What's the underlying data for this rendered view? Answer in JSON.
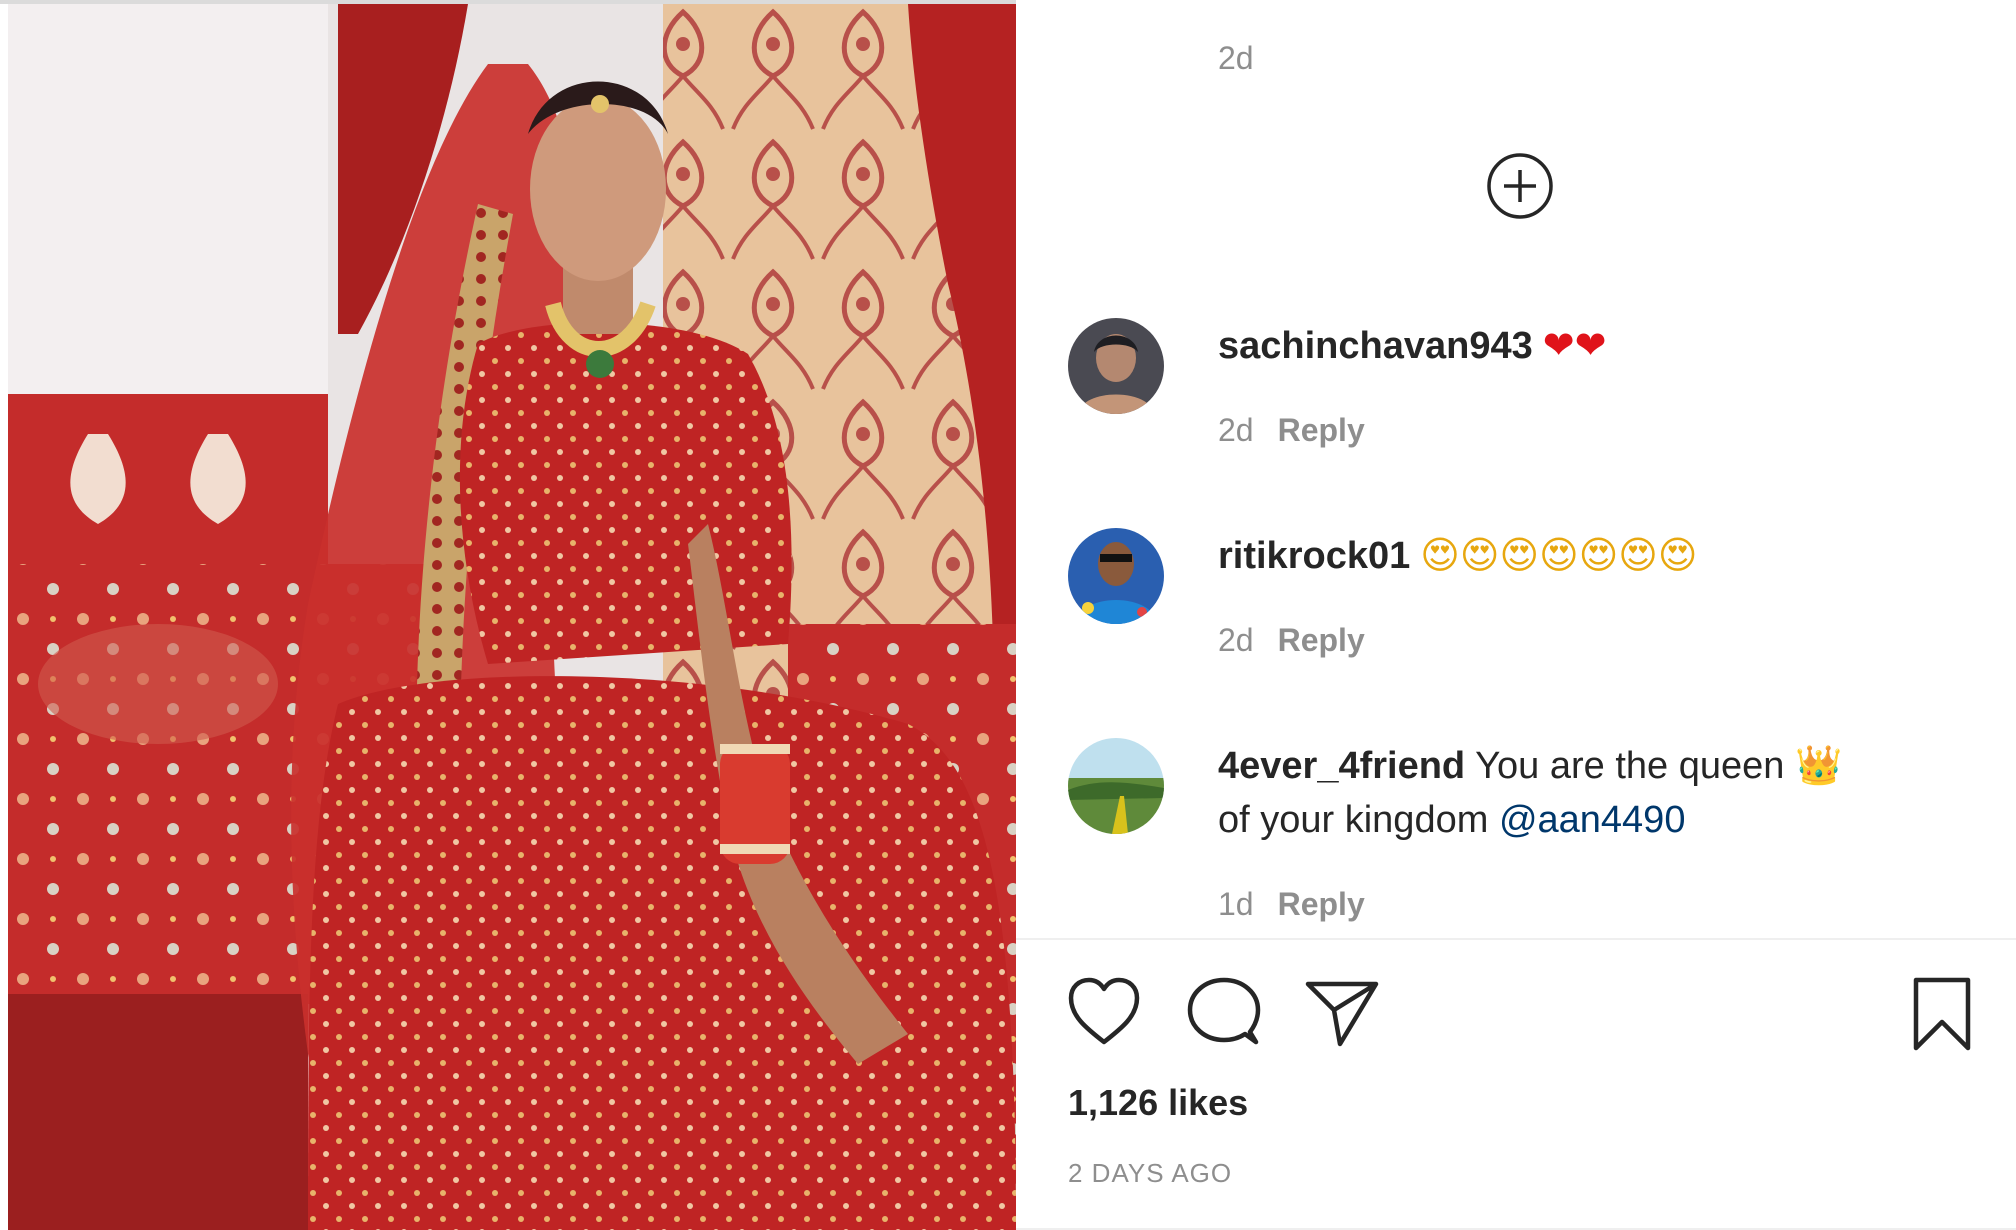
{
  "post": {
    "image_alt": "Woman in red bridal lehenga seated on a bed",
    "top_timestamp": "2d",
    "load_more_icon": "plus-circle-icon",
    "comments": [
      {
        "username": "sachinchavan943",
        "text": "",
        "emojis": "❤❤",
        "time": "2d",
        "reply_label": "Reply"
      },
      {
        "username": "ritikrock01",
        "text": "",
        "emojis": "😍😍😍😍😍😍😍",
        "time": "2d",
        "reply_label": "Reply"
      },
      {
        "username": "4ever_4friend",
        "text": "You are the queen",
        "emojis": "👑",
        "text_after": "of your kingdom",
        "mention": "@aan4490",
        "time": "1d",
        "reply_label": "Reply"
      }
    ],
    "actions": {
      "like_icon": "heart-icon",
      "comment_icon": "comment-bubble-icon",
      "share_icon": "paper-plane-icon",
      "save_icon": "bookmark-icon"
    },
    "likes": "1,126 likes",
    "posted_ago": "2 DAYS AGO"
  },
  "colors": {
    "text": "#262626",
    "muted": "#8e8e8e",
    "mention": "#00376b",
    "divider": "#efefef"
  }
}
